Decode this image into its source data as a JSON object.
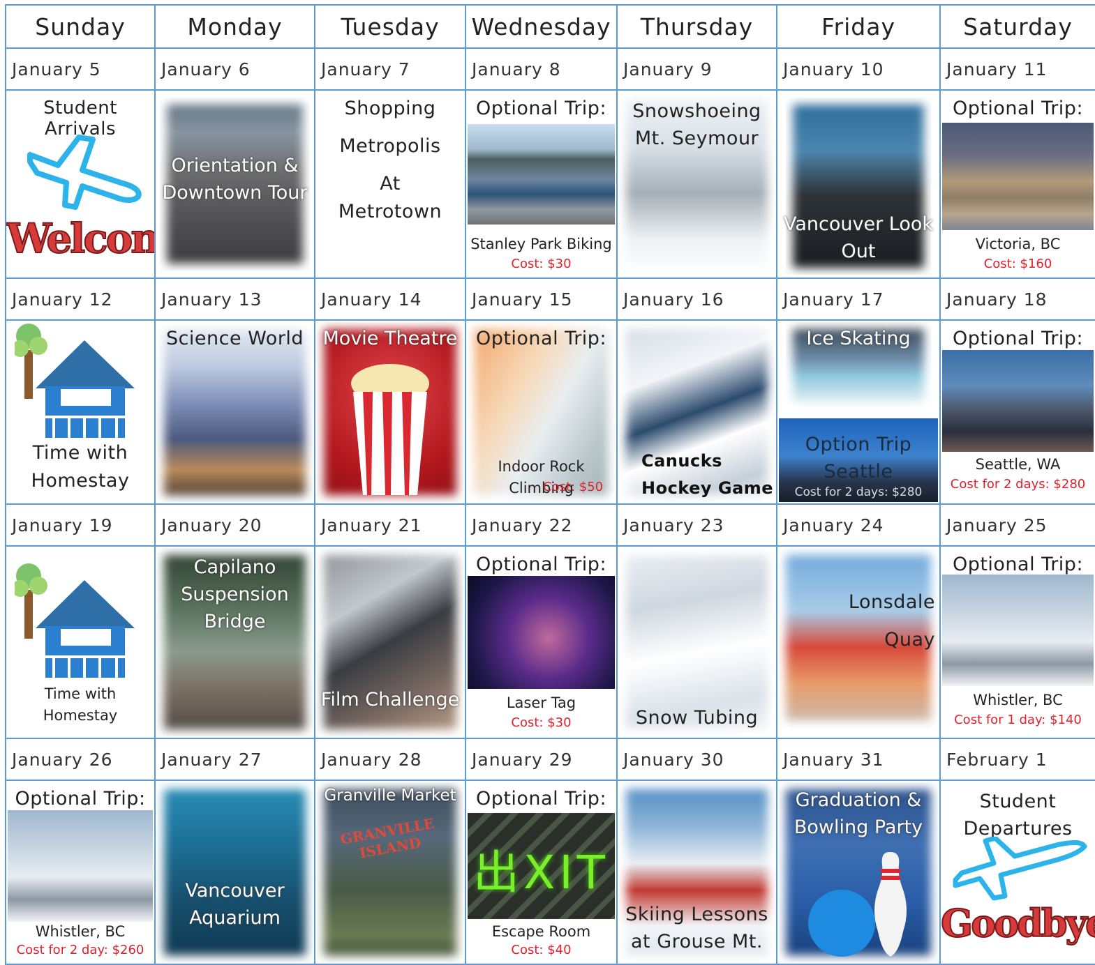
{
  "days": [
    "Sunday",
    "Monday",
    "Tuesday",
    "Wednesday",
    "Thursday",
    "Friday",
    "Saturday"
  ],
  "weeks": [
    {
      "dates": [
        "January 5",
        "January 6",
        "January 7",
        "January 8",
        "January 9",
        "January 10",
        "January 11"
      ],
      "events": [
        {
          "title": "Student Arrivals",
          "badge": "Welcome!"
        },
        {
          "overlay": "Orientation & Downtown Tour"
        },
        {
          "lines": [
            "Shopping",
            "Metropolis",
            "At",
            "Metrotown"
          ]
        },
        {
          "title": "Optional Trip:",
          "caption": "Stanley Park Biking",
          "cost": "Cost: $30"
        },
        {
          "overlay": "Snowshoeing Mt. Seymour"
        },
        {
          "overlay": "Vancouver Look Out"
        },
        {
          "title": "Optional Trip:",
          "caption": "Victoria, BC",
          "cost": "Cost: $160"
        }
      ]
    },
    {
      "dates": [
        "January 12",
        "January 13",
        "January 14",
        "January 15",
        "January 16",
        "January 17",
        "January 18"
      ],
      "events": [
        {
          "caption": "Time with Homestay"
        },
        {
          "overlay": "Science World"
        },
        {
          "overlay": "Movie Theatre"
        },
        {
          "title": "Optional Trip:",
          "caption": "Indoor Rock Climbing",
          "cost": "Cost: $50"
        },
        {
          "overlay": "Canucks Hockey Game"
        },
        {
          "overlay": "Ice Skating",
          "overlay2": "Option Trip Seattle",
          "cost": "Cost for 2 days: $280"
        },
        {
          "title": "Optional Trip:",
          "caption": "Seattle, WA",
          "cost": "Cost for 2 days: $280"
        }
      ]
    },
    {
      "dates": [
        "January 19",
        "January 20",
        "January 21",
        "January 22",
        "January 23",
        "January 24",
        "January 25"
      ],
      "events": [
        {
          "caption": "Time with Homestay"
        },
        {
          "overlay": "Capilano Suspension Bridge"
        },
        {
          "overlay": "Film Challenge"
        },
        {
          "title": "Optional Trip:",
          "caption": "Laser Tag",
          "cost": "Cost: $30"
        },
        {
          "overlay": "Snow Tubing"
        },
        {
          "lines": [
            "Lonsdale",
            "Quay"
          ]
        },
        {
          "title": "Optional Trip:",
          "caption": "Whistler, BC",
          "cost": "Cost for 1 day: $140"
        }
      ]
    },
    {
      "dates": [
        "January 26",
        "January 27",
        "January 28",
        "January 29",
        "January 30",
        "January 31",
        "February 1"
      ],
      "events": [
        {
          "title": "Optional Trip:",
          "caption": "Whistler, BC",
          "cost": "Cost for 2 day: $260"
        },
        {
          "overlay": "Vancouver Aquarium"
        },
        {
          "overlay": "Granville Market",
          "sign": "GRANVILLE ISLAND"
        },
        {
          "title": "Optional Trip:",
          "caption": "Escape Room",
          "cost": "Cost: $40",
          "sign": "出XIT"
        },
        {
          "overlay": "Skiing Lessons at Grouse Mt."
        },
        {
          "overlay": "Graduation & Bowling Party"
        },
        {
          "title": "Student Departures",
          "badge": "Goodbye!"
        }
      ]
    }
  ]
}
